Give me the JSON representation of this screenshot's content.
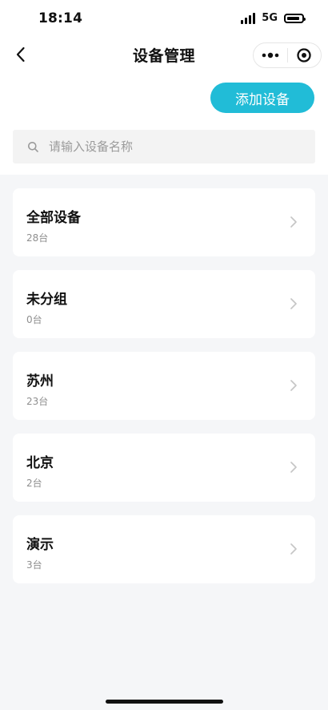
{
  "status_bar": {
    "time": "18:14",
    "network": "5G"
  },
  "header": {
    "title": "设备管理"
  },
  "actions": {
    "add_device_label": "添加设备"
  },
  "search": {
    "placeholder": "请输入设备名称",
    "value": ""
  },
  "groups": [
    {
      "name": "全部设备",
      "count": "28台"
    },
    {
      "name": "未分组",
      "count": "0台"
    },
    {
      "name": "苏州",
      "count": "23台"
    },
    {
      "name": "北京",
      "count": "2台"
    },
    {
      "name": "演示",
      "count": "3台"
    }
  ],
  "colors": {
    "accent": "#21bcd7",
    "background": "#f5f6f8",
    "card": "#ffffff"
  },
  "icons": {
    "back": "chevron-left-icon",
    "more": "more-dots-icon",
    "close": "target-circle-icon",
    "search": "search-icon",
    "chevron": "chevron-right-icon"
  }
}
